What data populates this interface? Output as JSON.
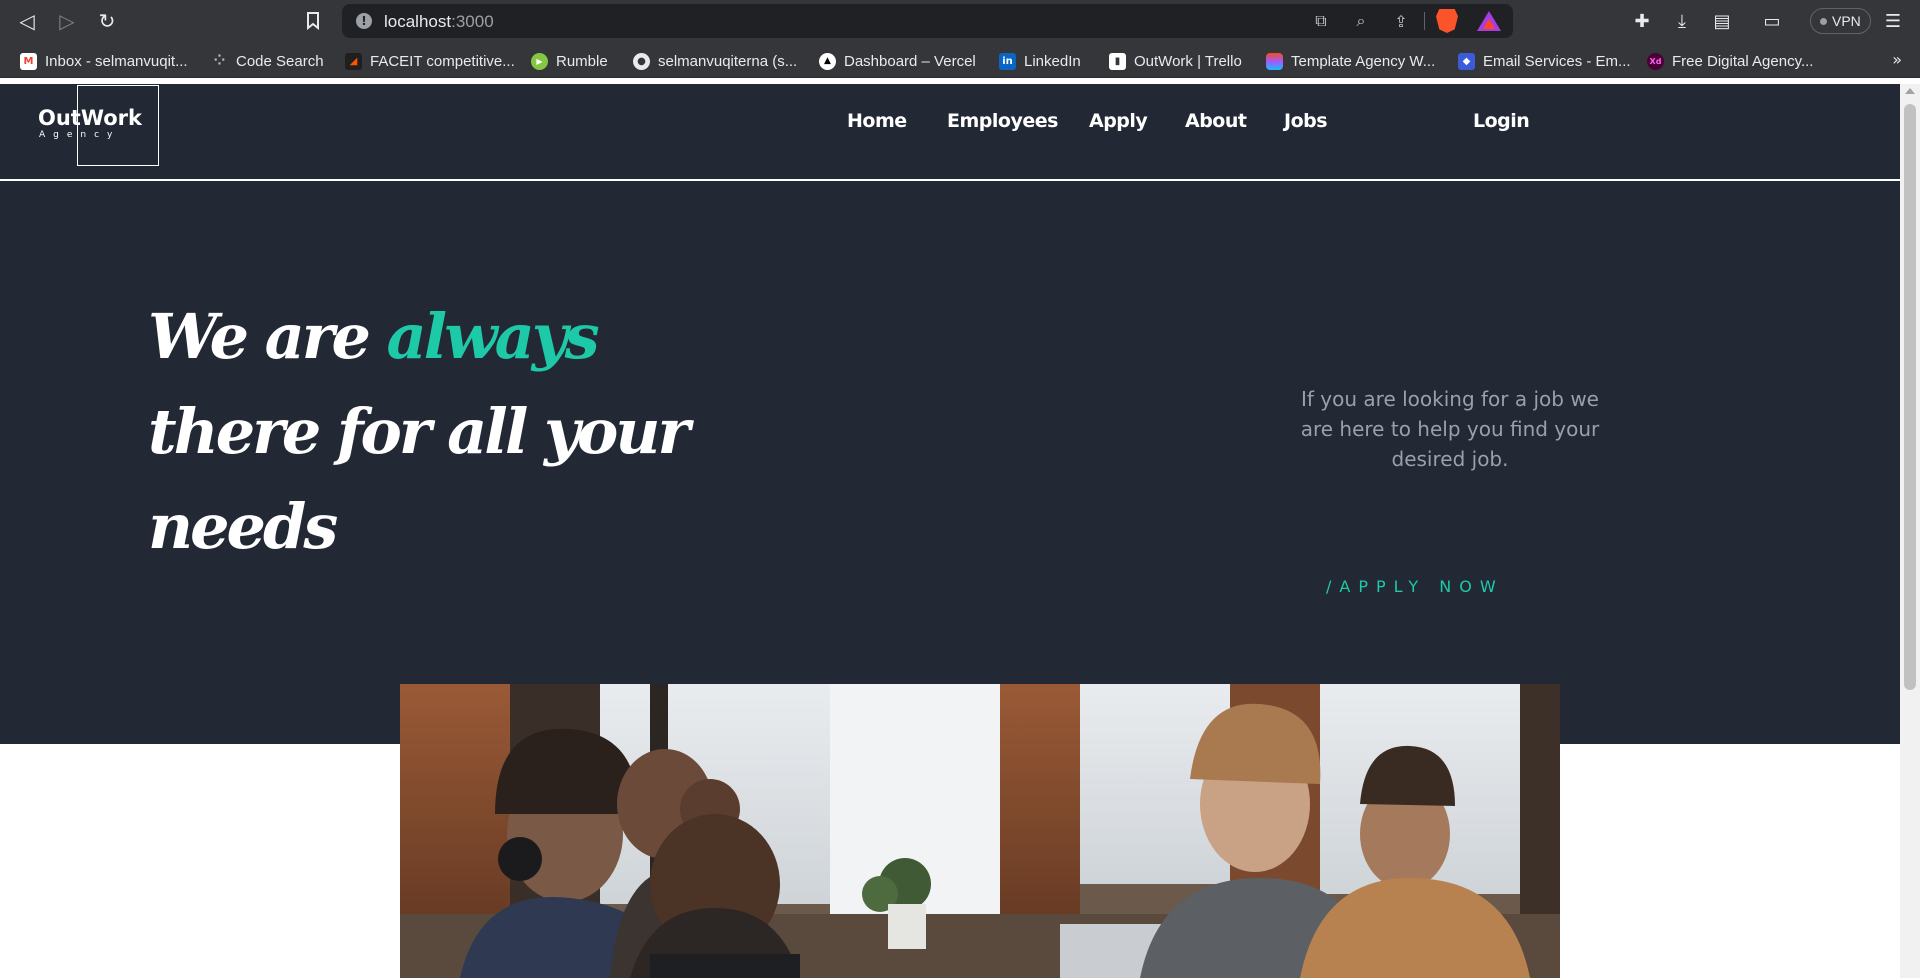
{
  "browser": {
    "url_host": "localhost",
    "url_port": ":3000",
    "vpn_label": "VPN",
    "bookmarks": [
      {
        "label": "Inbox - selmanvuqit...",
        "icon": "gmail-icon",
        "color": "#ea4335",
        "glyph": "M"
      },
      {
        "label": "Code Search",
        "icon": "code-search-icon",
        "color": "#35363a",
        "glyph": "⁘"
      },
      {
        "label": "FACEIT competitive...",
        "icon": "faceit-icon",
        "color": "#ff5500",
        "glyph": "◢"
      },
      {
        "label": "Rumble",
        "icon": "rumble-icon",
        "color": "#85c742",
        "glyph": "▶"
      },
      {
        "label": "selmanvuqiterna (s...",
        "icon": "github-icon",
        "color": "#35363a",
        "glyph": "●"
      },
      {
        "label": "Dashboard – Vercel",
        "icon": "vercel-icon",
        "color": "#000000",
        "glyph": "▲"
      },
      {
        "label": "LinkedIn",
        "icon": "linkedin-icon",
        "color": "#0a66c2",
        "glyph": "in"
      },
      {
        "label": "OutWork | Trello",
        "icon": "trello-icon",
        "color": "#ffffff",
        "glyph": "▮"
      },
      {
        "label": "Template Agency W...",
        "icon": "figma-icon",
        "color": "#a259ff",
        "glyph": "●"
      },
      {
        "label": "Email Services - Em...",
        "icon": "email-services-icon",
        "color": "#3b5bdb",
        "glyph": "◆"
      },
      {
        "label": "Free Digital Agency...",
        "icon": "xd-icon",
        "color": "#470137",
        "glyph": "Xd"
      }
    ],
    "more_bookmarks": "»"
  },
  "header": {
    "logo_title": "OutWork",
    "logo_subtitle": "Agency",
    "nav": {
      "home": "Home",
      "employees": "Employees",
      "apply": "Apply",
      "about": "About",
      "jobs": "Jobs",
      "login": "Login"
    }
  },
  "hero": {
    "headline_prefix": "We are ",
    "headline_accent": "always",
    "headline_line2": "there for all your",
    "headline_line3": "needs",
    "tagline": "If you are looking for a job we are here to help you find your desired job.",
    "cta": "/APPLY NOW"
  },
  "colors": {
    "hero_background": "#222834",
    "accent": "#1ec9a8",
    "tagline_text": "#9aa0a8"
  }
}
